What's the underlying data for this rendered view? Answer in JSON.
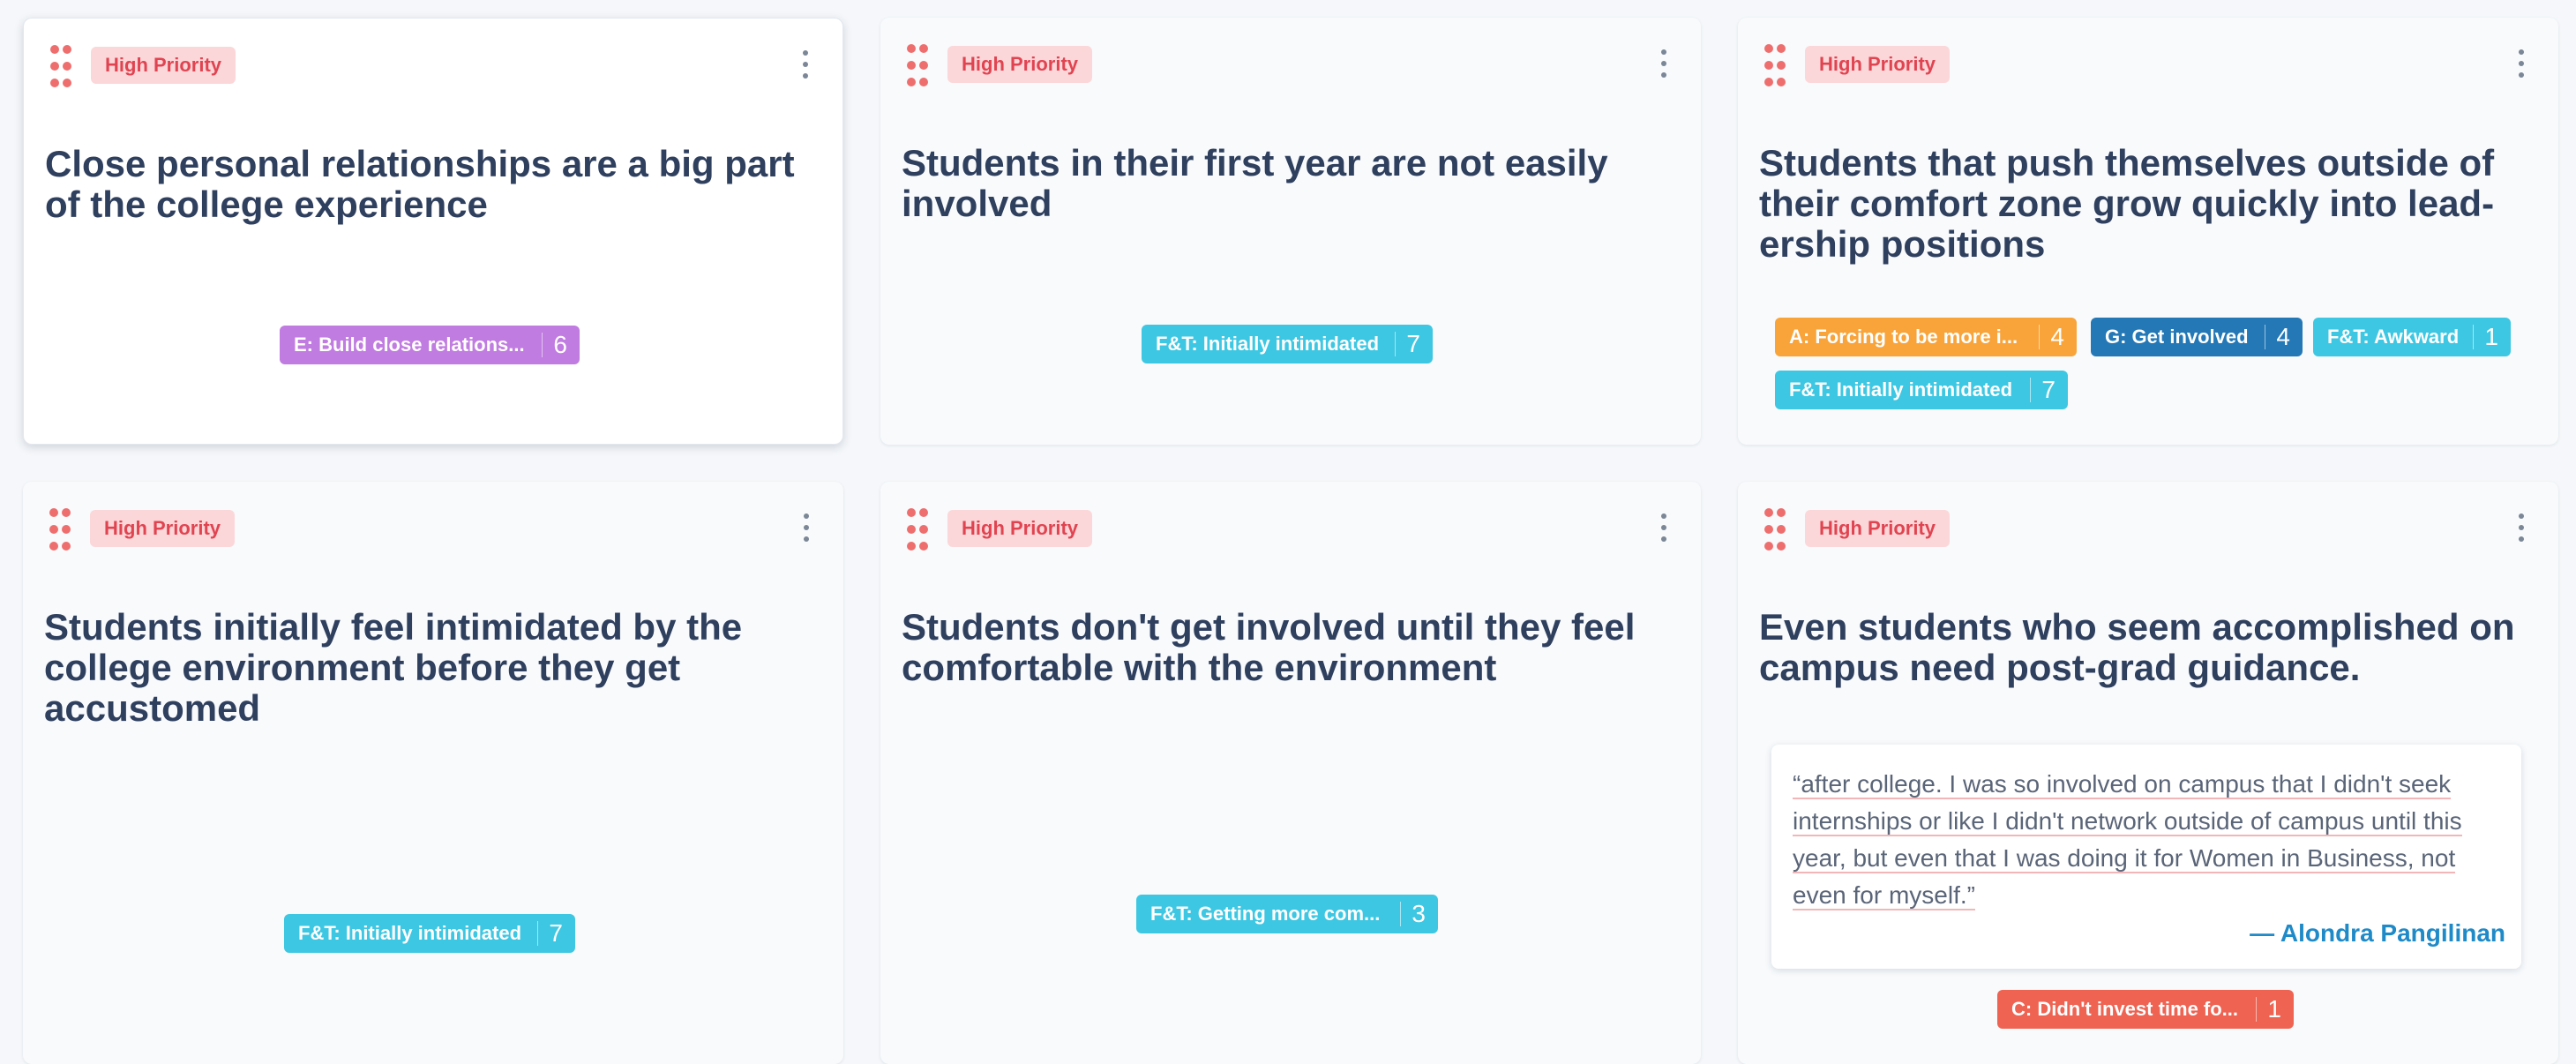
{
  "cards": [
    {
      "priority": "High Priority",
      "title": "Close personal relationships are a big part of the college experience",
      "tags": [
        {
          "label": "E: Build close relations...",
          "count": "6",
          "color": "#c07ce0"
        }
      ]
    },
    {
      "priority": "High Priority",
      "title": "Students in their first year are not easily involved",
      "tags": [
        {
          "label": "F&T: Initially intimidated",
          "count": "7",
          "color": "#3ec7e2"
        }
      ]
    },
    {
      "priority": "High Priority",
      "title": "Students that push themselves outside of their comfort zone grow quickly into lead-ership positions",
      "tags": [
        {
          "label": "A: Forcing to be more i...",
          "count": "4",
          "color": "#f8a43a"
        },
        {
          "label": "G: Get involved",
          "count": "4",
          "color": "#2478b6"
        },
        {
          "label": "F&T: Awkward",
          "count": "1",
          "color": "#3ec7e2"
        },
        {
          "label": "F&T: Initially intimidated",
          "count": "7",
          "color": "#3ec7e2"
        }
      ]
    },
    {
      "priority": "High Priority",
      "title": "Students initially feel intimidated by the college environment before they get accustomed",
      "tags": [
        {
          "label": "F&T: Initially intimidated",
          "count": "7",
          "color": "#3ec7e2"
        }
      ]
    },
    {
      "priority": "High Priority",
      "title": "Students don't get involved until they feel comfortable with the environment",
      "tags": [
        {
          "label": "F&T: Getting more com...",
          "count": "3",
          "color": "#3ec7e2"
        }
      ]
    },
    {
      "priority": "High Priority",
      "title": "Even students who seem accomplished on campus need post-grad guidance.",
      "quote": {
        "text": "“after college. I was so involved on campus that I didn't seek internships or like I didn't network outside of campus until this year, but even that I was doing it for Women in Business, not even for myself.”",
        "author": "— Alondra Pangilinan"
      },
      "tags": [
        {
          "label": "C: Didn't invest time fo...",
          "count": "1",
          "color": "#ee6352"
        }
      ]
    }
  ]
}
